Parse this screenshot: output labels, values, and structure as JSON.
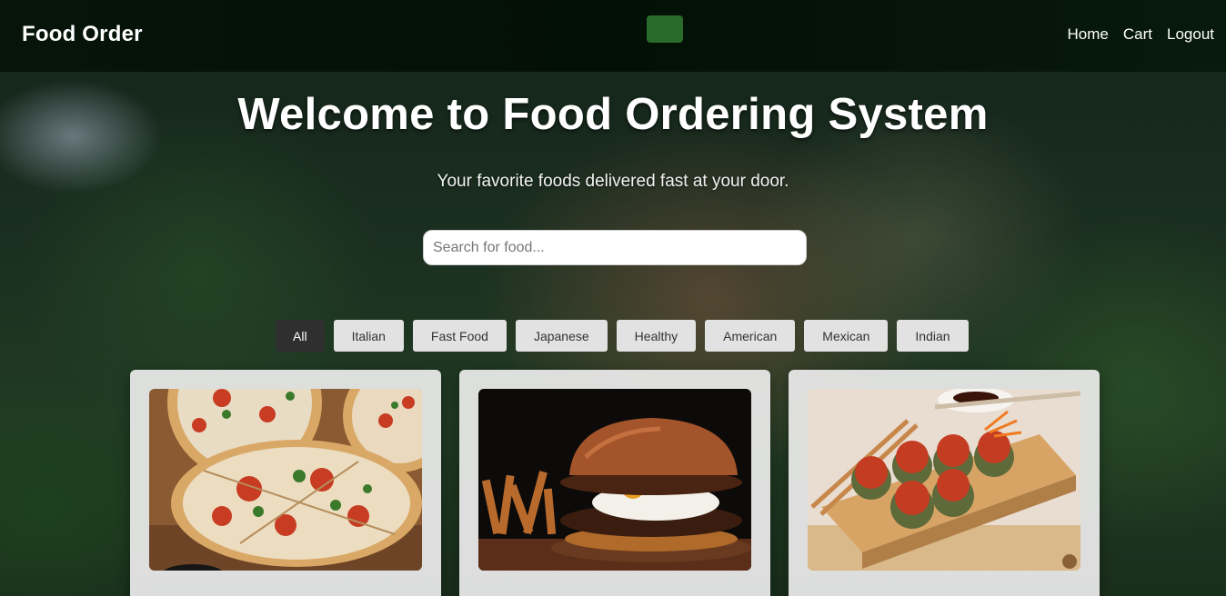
{
  "navbar": {
    "brand": "Food Order",
    "links": [
      "Home",
      "Cart",
      "Logout"
    ],
    "accent": "#2a6a2a"
  },
  "hero": {
    "title": "Welcome to Food Ordering System",
    "subtitle": "Your favorite foods delivered fast at your door."
  },
  "search": {
    "placeholder": "Search for food...",
    "value": ""
  },
  "categories": {
    "active": "All",
    "items": [
      "All",
      "Italian",
      "Fast Food",
      "Japanese",
      "Healthy",
      "American",
      "Mexican",
      "Indian"
    ]
  },
  "food_cards": [
    {
      "image": "pizza-image"
    },
    {
      "image": "burger-image"
    },
    {
      "image": "sushi-image"
    }
  ]
}
